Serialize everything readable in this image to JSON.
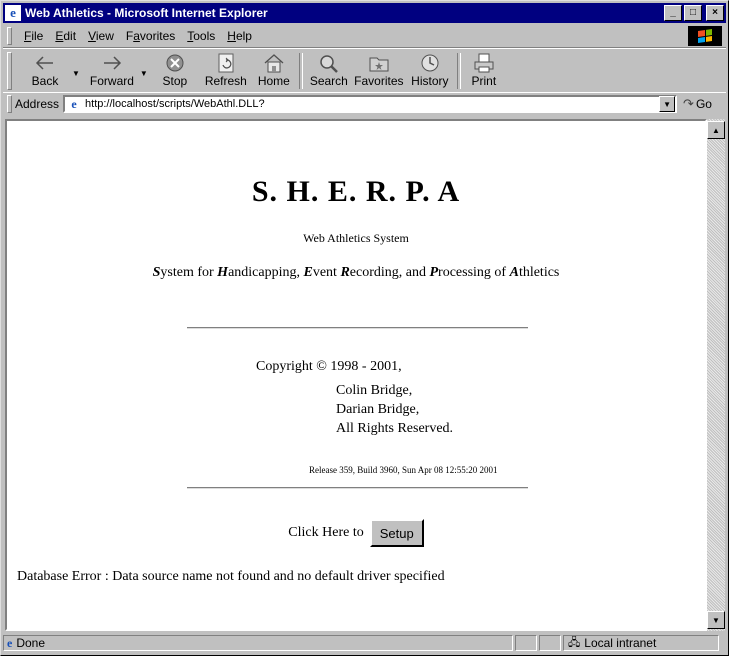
{
  "window": {
    "title": "Web Athletics - Microsoft Internet Explorer",
    "controls": {
      "minimize": "_",
      "maximize": "□",
      "close": "×"
    }
  },
  "menu": {
    "items": [
      "File",
      "Edit",
      "View",
      "Favorites",
      "Tools",
      "Help"
    ],
    "underline_index": [
      0,
      0,
      0,
      1,
      0,
      0
    ]
  },
  "toolbar": {
    "buttons": [
      {
        "label": "Back",
        "icon": "back-arrow-icon"
      },
      {
        "label": "Forward",
        "icon": "forward-arrow-icon"
      },
      {
        "label": "Stop",
        "icon": "stop-icon"
      },
      {
        "label": "Refresh",
        "icon": "refresh-icon"
      },
      {
        "label": "Home",
        "icon": "home-icon"
      },
      {
        "label": "Search",
        "icon": "search-icon"
      },
      {
        "label": "Favorites",
        "icon": "favorites-icon"
      },
      {
        "label": "History",
        "icon": "history-icon"
      },
      {
        "label": "Print",
        "icon": "print-icon"
      }
    ]
  },
  "address": {
    "label": "Address",
    "url": "http://localhost/scripts/WebAthl.DLL?",
    "go_label": "Go"
  },
  "page": {
    "title": "S. H. E. R. P. A",
    "subtitle": "Web Athletics System",
    "acronym": [
      {
        "letter": "S",
        "rest": "ystem for "
      },
      {
        "letter": "H",
        "rest": "andicapping, "
      },
      {
        "letter": "E",
        "rest": "vent "
      },
      {
        "letter": "R",
        "rest": "ecording, and "
      },
      {
        "letter": "P",
        "rest": "rocessing of "
      },
      {
        "letter": "A",
        "rest": "thletics"
      }
    ],
    "copyright": "Copyright © 1998 - 2001,",
    "names": [
      "Colin Bridge,",
      "Darian Bridge,",
      "All Rights Reserved."
    ],
    "release": "Release 359, Build 3960, Sun Apr 08 12:55:20 2001",
    "click_prefix": "Click Here to",
    "setup_button": "Setup",
    "error": "Database Error : Data source name not found and no default driver specified"
  },
  "status": {
    "text": "Done",
    "zone": "Local intranet"
  },
  "colors": {
    "titlebar": "#000080",
    "chrome": "#c0c0c0",
    "content_bg": "#ffffff"
  }
}
